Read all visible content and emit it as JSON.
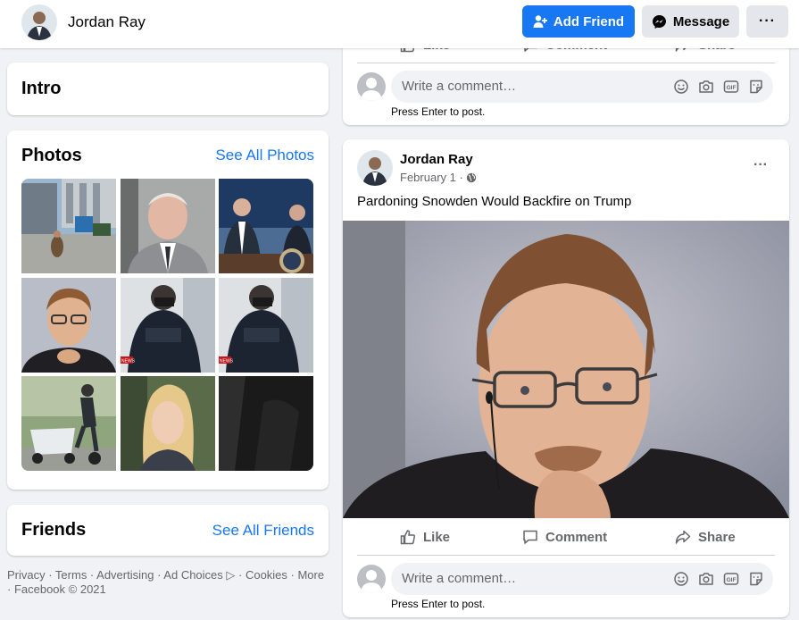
{
  "header": {
    "name": "Jordan Ray",
    "add_friend_label": "Add Friend",
    "message_label": "Message",
    "more_label": "···"
  },
  "intro": {
    "title": "Intro"
  },
  "photos": {
    "title": "Photos",
    "see_all": "See All Photos",
    "news_badge": "NEWS"
  },
  "friends": {
    "title": "Friends",
    "see_all": "See All Friends"
  },
  "footer": {
    "text": "Privacy · Terms · Advertising · Ad Choices ▷ · Cookies · More · Facebook © 2021"
  },
  "prev_post": {
    "actions": {
      "like": "Like",
      "comment": "Comment",
      "share": "Share"
    },
    "comment_placeholder": "Write a comment…",
    "press_enter": "Press Enter to post."
  },
  "post": {
    "author": "Jordan Ray",
    "date": "February 1 ·",
    "menu": "···",
    "text": "Pardoning Snowden Would Backfire on Trump",
    "actions": {
      "like": "Like",
      "comment": "Comment",
      "share": "Share"
    },
    "comment_placeholder": "Write a comment…",
    "gif_label": "GIF",
    "press_enter": "Press Enter to post."
  },
  "colors": {
    "accent": "#1877f2",
    "background": "#f0f2f5",
    "muted": "#65676b"
  }
}
